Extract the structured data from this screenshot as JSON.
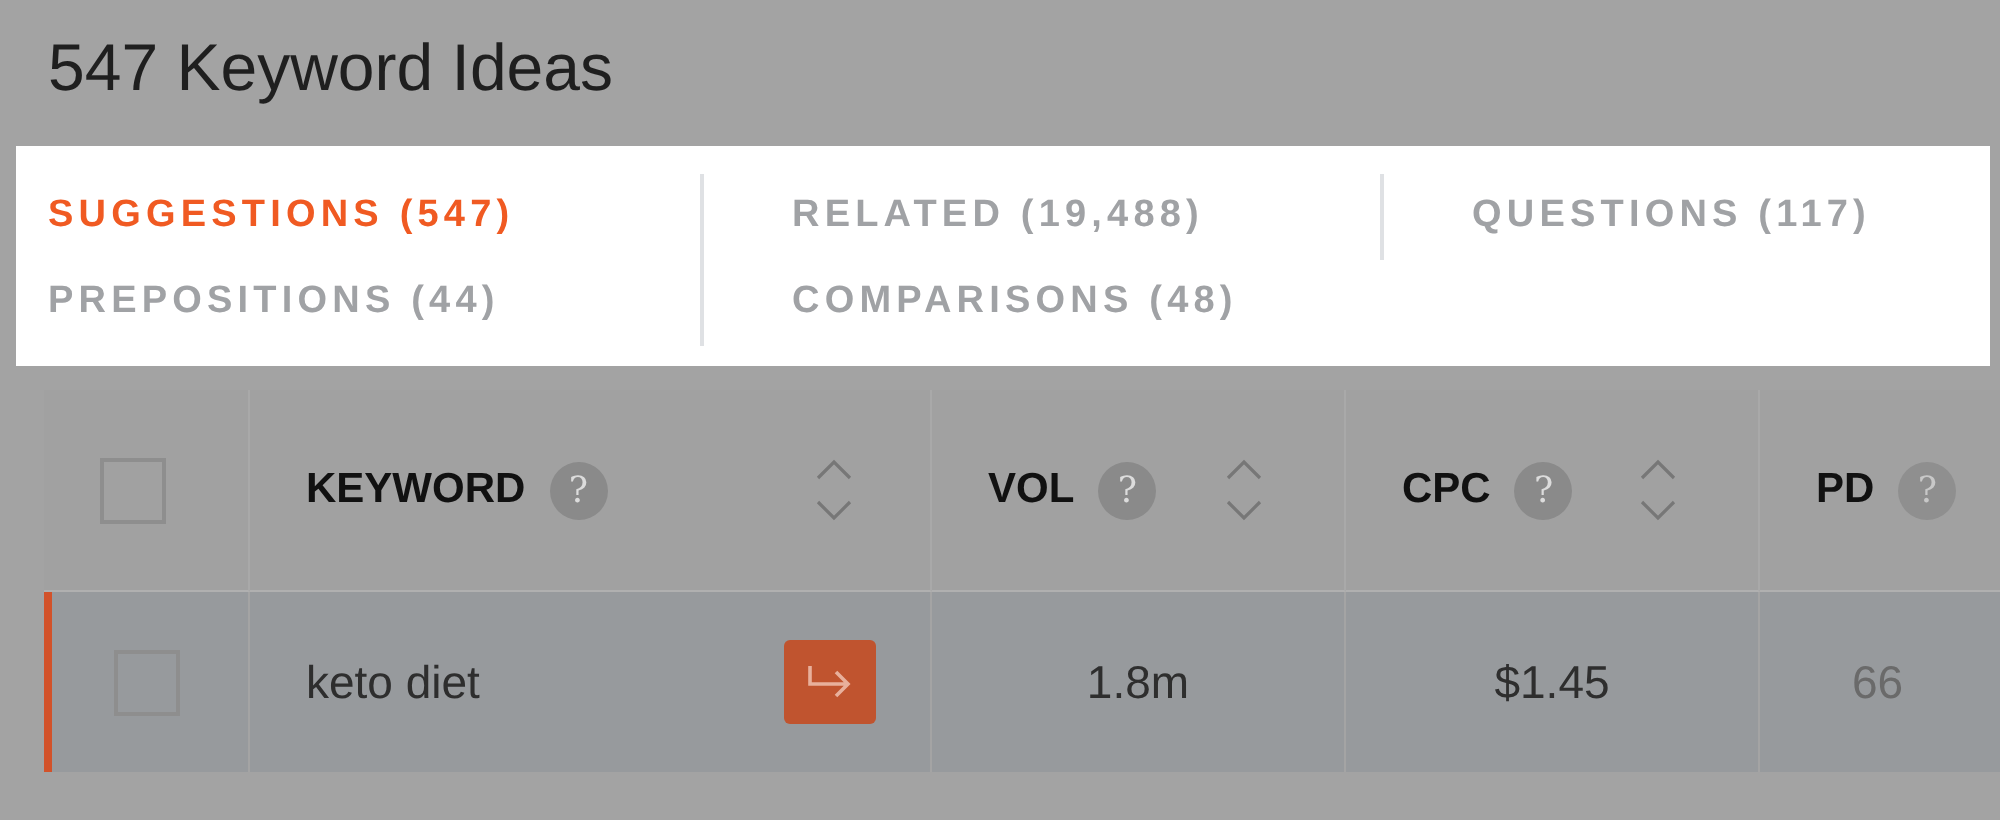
{
  "title": "547 Keyword Ideas",
  "tabs": [
    {
      "label": "SUGGESTIONS (547)",
      "selected": true
    },
    {
      "label": "RELATED (19,488)",
      "selected": false
    },
    {
      "label": "QUESTIONS (117)",
      "selected": false
    },
    {
      "label": "PREPOSITIONS (44)",
      "selected": false
    },
    {
      "label": "COMPARISONS (48)",
      "selected": false
    }
  ],
  "table": {
    "select_all_checked": false,
    "columns": [
      {
        "label": "KEYWORD",
        "help": "?",
        "sortable": true
      },
      {
        "label": "VOL",
        "help": "?",
        "sortable": true
      },
      {
        "label": "CPC",
        "help": "?",
        "sortable": true
      },
      {
        "label": "PD",
        "help": "?",
        "sortable": false
      }
    ],
    "rows": [
      {
        "checked": false,
        "highlighted": true,
        "cells": [
          "keto diet",
          "1.8m",
          "$1.45",
          "66"
        ]
      }
    ]
  }
}
